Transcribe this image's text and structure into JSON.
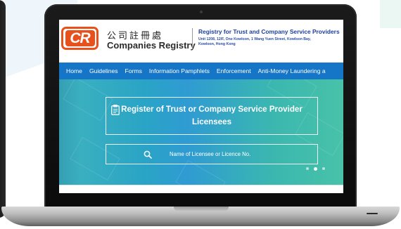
{
  "logo": {
    "mark": "CR",
    "name_zh": "公司註冊處",
    "name_en": "Companies Registry"
  },
  "registry": {
    "title": "Registry for Trust and Company Service Providers",
    "address_line1": "Unit 1208, 12/F, One Kowloon, 1 Wang Yuen Street, Kowloon Bay,",
    "address_line2": "Kowloon, Hong Kong"
  },
  "nav": {
    "items": [
      {
        "label": "Home"
      },
      {
        "label": "Guidelines"
      },
      {
        "label": "Forms"
      },
      {
        "label": "Information Pamphlets"
      },
      {
        "label": "Enforcement"
      },
      {
        "label": "Anti-Money Laundering a"
      }
    ]
  },
  "hero": {
    "title": "Register of Trust or Company Service Provider Licensees",
    "search_placeholder": "Name of Licensee or Licence No.",
    "carousel_active_index": 1,
    "carousel_count": 3
  },
  "colors": {
    "brand_orange": "#e8501c",
    "nav_blue": "#1576c8",
    "registry_blue": "#1f3f9a"
  }
}
